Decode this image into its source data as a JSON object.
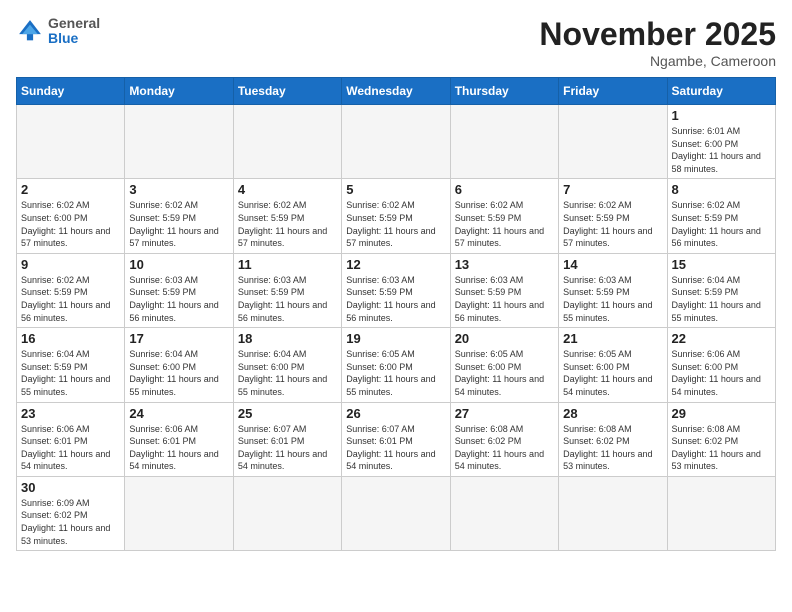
{
  "header": {
    "logo_general": "General",
    "logo_blue": "Blue",
    "month_title": "November 2025",
    "location": "Ngambe, Cameroon"
  },
  "weekdays": [
    "Sunday",
    "Monday",
    "Tuesday",
    "Wednesday",
    "Thursday",
    "Friday",
    "Saturday"
  ],
  "days": {
    "d1": {
      "num": "1",
      "sunrise": "6:01 AM",
      "sunset": "6:00 PM",
      "daylight": "11 hours and 58 minutes."
    },
    "d2": {
      "num": "2",
      "sunrise": "6:02 AM",
      "sunset": "6:00 PM",
      "daylight": "11 hours and 57 minutes."
    },
    "d3": {
      "num": "3",
      "sunrise": "6:02 AM",
      "sunset": "5:59 PM",
      "daylight": "11 hours and 57 minutes."
    },
    "d4": {
      "num": "4",
      "sunrise": "6:02 AM",
      "sunset": "5:59 PM",
      "daylight": "11 hours and 57 minutes."
    },
    "d5": {
      "num": "5",
      "sunrise": "6:02 AM",
      "sunset": "5:59 PM",
      "daylight": "11 hours and 57 minutes."
    },
    "d6": {
      "num": "6",
      "sunrise": "6:02 AM",
      "sunset": "5:59 PM",
      "daylight": "11 hours and 57 minutes."
    },
    "d7": {
      "num": "7",
      "sunrise": "6:02 AM",
      "sunset": "5:59 PM",
      "daylight": "11 hours and 57 minutes."
    },
    "d8": {
      "num": "8",
      "sunrise": "6:02 AM",
      "sunset": "5:59 PM",
      "daylight": "11 hours and 56 minutes."
    },
    "d9": {
      "num": "9",
      "sunrise": "6:02 AM",
      "sunset": "5:59 PM",
      "daylight": "11 hours and 56 minutes."
    },
    "d10": {
      "num": "10",
      "sunrise": "6:03 AM",
      "sunset": "5:59 PM",
      "daylight": "11 hours and 56 minutes."
    },
    "d11": {
      "num": "11",
      "sunrise": "6:03 AM",
      "sunset": "5:59 PM",
      "daylight": "11 hours and 56 minutes."
    },
    "d12": {
      "num": "12",
      "sunrise": "6:03 AM",
      "sunset": "5:59 PM",
      "daylight": "11 hours and 56 minutes."
    },
    "d13": {
      "num": "13",
      "sunrise": "6:03 AM",
      "sunset": "5:59 PM",
      "daylight": "11 hours and 56 minutes."
    },
    "d14": {
      "num": "14",
      "sunrise": "6:03 AM",
      "sunset": "5:59 PM",
      "daylight": "11 hours and 55 minutes."
    },
    "d15": {
      "num": "15",
      "sunrise": "6:04 AM",
      "sunset": "5:59 PM",
      "daylight": "11 hours and 55 minutes."
    },
    "d16": {
      "num": "16",
      "sunrise": "6:04 AM",
      "sunset": "5:59 PM",
      "daylight": "11 hours and 55 minutes."
    },
    "d17": {
      "num": "17",
      "sunrise": "6:04 AM",
      "sunset": "6:00 PM",
      "daylight": "11 hours and 55 minutes."
    },
    "d18": {
      "num": "18",
      "sunrise": "6:04 AM",
      "sunset": "6:00 PM",
      "daylight": "11 hours and 55 minutes."
    },
    "d19": {
      "num": "19",
      "sunrise": "6:05 AM",
      "sunset": "6:00 PM",
      "daylight": "11 hours and 55 minutes."
    },
    "d20": {
      "num": "20",
      "sunrise": "6:05 AM",
      "sunset": "6:00 PM",
      "daylight": "11 hours and 54 minutes."
    },
    "d21": {
      "num": "21",
      "sunrise": "6:05 AM",
      "sunset": "6:00 PM",
      "daylight": "11 hours and 54 minutes."
    },
    "d22": {
      "num": "22",
      "sunrise": "6:06 AM",
      "sunset": "6:00 PM",
      "daylight": "11 hours and 54 minutes."
    },
    "d23": {
      "num": "23",
      "sunrise": "6:06 AM",
      "sunset": "6:01 PM",
      "daylight": "11 hours and 54 minutes."
    },
    "d24": {
      "num": "24",
      "sunrise": "6:06 AM",
      "sunset": "6:01 PM",
      "daylight": "11 hours and 54 minutes."
    },
    "d25": {
      "num": "25",
      "sunrise": "6:07 AM",
      "sunset": "6:01 PM",
      "daylight": "11 hours and 54 minutes."
    },
    "d26": {
      "num": "26",
      "sunrise": "6:07 AM",
      "sunset": "6:01 PM",
      "daylight": "11 hours and 54 minutes."
    },
    "d27": {
      "num": "27",
      "sunrise": "6:08 AM",
      "sunset": "6:02 PM",
      "daylight": "11 hours and 54 minutes."
    },
    "d28": {
      "num": "28",
      "sunrise": "6:08 AM",
      "sunset": "6:02 PM",
      "daylight": "11 hours and 53 minutes."
    },
    "d29": {
      "num": "29",
      "sunrise": "6:08 AM",
      "sunset": "6:02 PM",
      "daylight": "11 hours and 53 minutes."
    },
    "d30": {
      "num": "30",
      "sunrise": "6:09 AM",
      "sunset": "6:02 PM",
      "daylight": "11 hours and 53 minutes."
    }
  },
  "labels": {
    "sunrise": "Sunrise:",
    "sunset": "Sunset:",
    "daylight": "Daylight:"
  }
}
